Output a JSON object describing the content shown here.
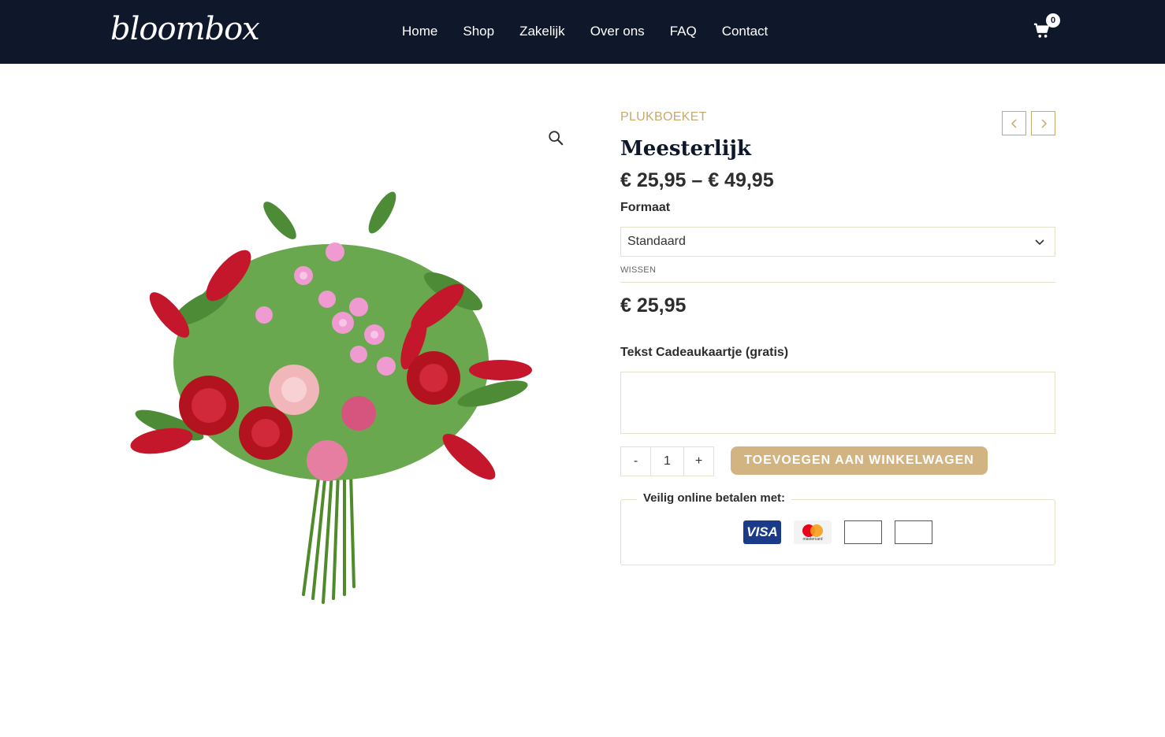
{
  "header": {
    "logo": "bloombox",
    "nav": [
      "Home",
      "Shop",
      "Zakelijk",
      "Over ons",
      "FAQ",
      "Contact"
    ],
    "cart_count": "0",
    "cart_icon": "cart-icon"
  },
  "product": {
    "category": "PLUKBOEKET",
    "title": "Meesterlijk",
    "price_range": "€ 25,95 – € 49,95",
    "format_label": "Formaat",
    "format_selected": "Standaard",
    "clear_label": "WISSEN",
    "variant_price": "€ 25,95",
    "card_label": "Tekst Cadeaukaartje (gratis)",
    "card_value": "",
    "qty_minus": "-",
    "qty_value": "1",
    "qty_plus": "+",
    "add_to_cart": "TOEVOEGEN AAN WINKELWAGEN"
  },
  "payment": {
    "legend": "Veilig online betalen met:",
    "visa": "VISA",
    "mastercard": "mastercard"
  },
  "colors": {
    "header_bg": "#0f172a",
    "accent": "#c8a96a",
    "button": "#d2b483"
  }
}
